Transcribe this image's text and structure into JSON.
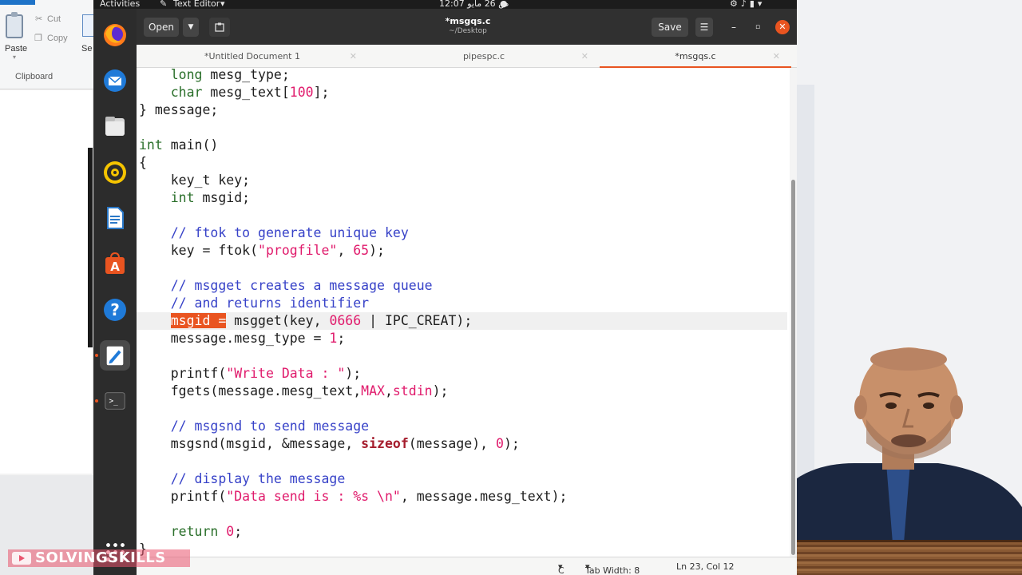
{
  "topbar": {
    "activities": "Activities",
    "app_name": "Text Editor",
    "clock": "12:07 ص 26 مايو",
    "app_icon": "pencil-icon"
  },
  "background_app": {
    "paste_label": "Paste",
    "cut_label": "Cut",
    "copy_label": "Copy",
    "select_fragment": "Se",
    "group_label": "Clipboard"
  },
  "header": {
    "open_label": "Open",
    "title": "*msgqs.c",
    "subtitle": "~/Desktop",
    "save_label": "Save"
  },
  "tabs": [
    {
      "label": "*Untitled Document 1"
    },
    {
      "label": "pipespc.c"
    },
    {
      "label": "*msgqs.c",
      "active": true
    }
  ],
  "dock": {
    "items": [
      "firefox-icon",
      "thunderbird-icon",
      "files-icon",
      "rhythmbox-icon",
      "writer-icon",
      "software-icon",
      "help-icon",
      "text-editor-icon",
      "terminal-icon"
    ],
    "active_index": 7
  },
  "code": {
    "current_line_index": 14,
    "selected_text": "msgid ="
  },
  "status": {
    "language": "C",
    "tab_width": "Tab Width: 8",
    "position": "Ln 23, Col 12"
  },
  "watermark": "SOLVINGSKILLS",
  "colors": {
    "accent": "#e95420",
    "comment": "#3742c8",
    "string": "#e01b6c",
    "keyword": "#2a6f2a"
  }
}
